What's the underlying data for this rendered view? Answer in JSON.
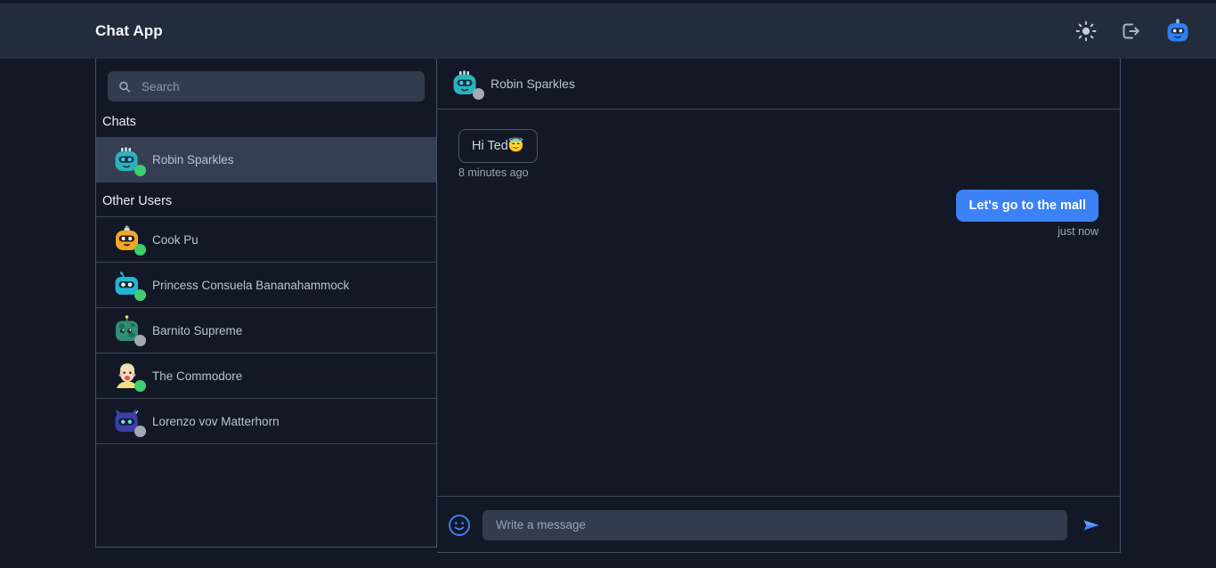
{
  "header": {
    "title": "Chat App",
    "actions": [
      {
        "name": "theme-toggle-icon",
        "icon": "sun-icon"
      },
      {
        "name": "logout-icon",
        "icon": "logout-icon"
      },
      {
        "name": "current-user-avatar",
        "icon": "robot-avatar-blue"
      }
    ]
  },
  "sidebar": {
    "search": {
      "placeholder": "Search",
      "value": ""
    },
    "chats_label": "Chats",
    "other_users_label": "Other Users",
    "chats": [
      {
        "name": "Robin Sparkles",
        "status": "online",
        "avatar": "robot-teal",
        "selected": true
      }
    ],
    "other_users": [
      {
        "name": "Cook Pu",
        "status": "online",
        "avatar": "robot-orange"
      },
      {
        "name": "Princess Consuela Bananahammock",
        "status": "online",
        "avatar": "robot-cyan"
      },
      {
        "name": "Barnito Supreme",
        "status": "offline",
        "avatar": "robot-green"
      },
      {
        "name": "The Commodore",
        "status": "online",
        "avatar": "person-blonde"
      },
      {
        "name": "Lorenzo vov Matterhorn",
        "status": "offline",
        "avatar": "robot-navy"
      }
    ]
  },
  "chat": {
    "contact": {
      "name": "Robin Sparkles",
      "status": "offline",
      "avatar": "robot-teal"
    },
    "messages": [
      {
        "direction": "incoming",
        "text": "Hi Ted😇",
        "time": "8 minutes ago"
      },
      {
        "direction": "outgoing",
        "text": "Let's go to the mall",
        "time": "just now"
      }
    ]
  },
  "composer": {
    "emoji_label": "emoji-picker",
    "placeholder": "Write a message",
    "value": "",
    "send_label": "send"
  },
  "colors": {
    "page_bg": "#131827",
    "header_bg": "#232c3d",
    "selected_row": "#363f52",
    "accent_blue": "#3b82f6",
    "online_green": "#3ecf72",
    "offline_gray": "#a4a9b3",
    "input_bg": "#333c4e",
    "border": "#44506a"
  }
}
